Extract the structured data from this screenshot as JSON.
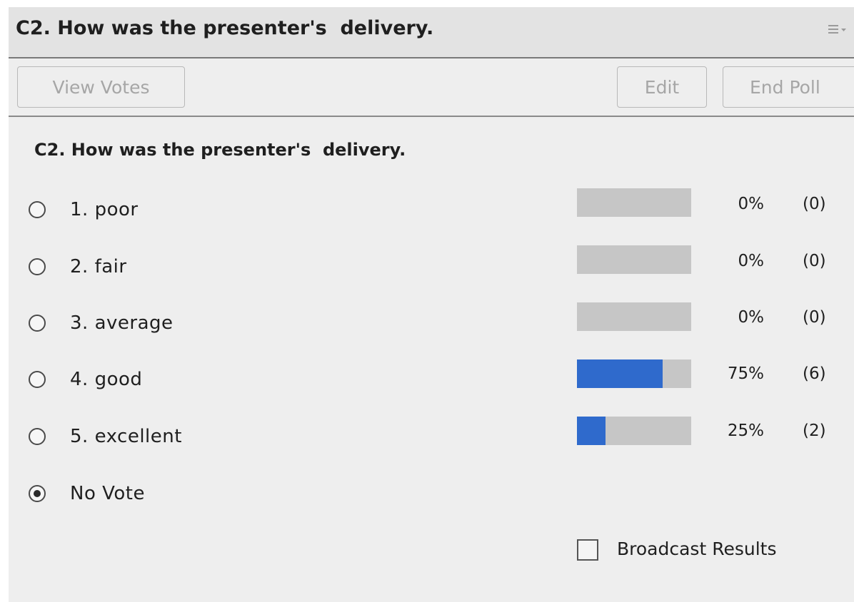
{
  "header": {
    "title": "C2. How was the presenter's  delivery.",
    "menu_icon": "hamburger-menu-icon"
  },
  "toolbar": {
    "view_votes_label": "View Votes",
    "edit_label": "Edit",
    "end_poll_label": "End Poll"
  },
  "poll": {
    "question": "C2. How was the presenter's  delivery.",
    "options": [
      {
        "label": "1. poor",
        "percent_text": "0%",
        "count_text": "(0)",
        "fraction": 0.0,
        "selected": false
      },
      {
        "label": "2. fair",
        "percent_text": "0%",
        "count_text": "(0)",
        "fraction": 0.0,
        "selected": false
      },
      {
        "label": "3. average",
        "percent_text": "0%",
        "count_text": "(0)",
        "fraction": 0.0,
        "selected": false
      },
      {
        "label": "4. good",
        "percent_text": "75%",
        "count_text": "(6)",
        "fraction": 0.75,
        "selected": false
      },
      {
        "label": "5. excellent",
        "percent_text": "25%",
        "count_text": "(2)",
        "fraction": 0.25,
        "selected": false
      }
    ],
    "no_vote": {
      "label": "No Vote",
      "selected": true
    },
    "broadcast_label": "Broadcast Results",
    "broadcast_checked": false
  },
  "colors": {
    "bar_fill": "#2f6acc",
    "bar_track": "#c6c6c6",
    "panel_bg": "#eeeeee",
    "titlebar_bg": "#e3e3e3"
  }
}
